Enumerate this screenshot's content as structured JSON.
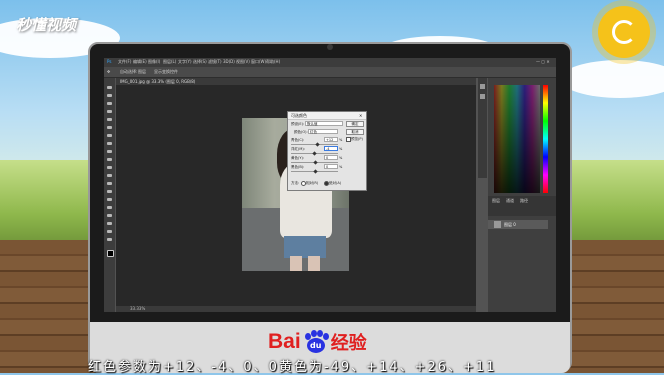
{
  "watermark": "秒懂视频",
  "brand": {
    "bai": "Bai",
    "du": "du",
    "suffix": "经验"
  },
  "caption": "红色参数为+12、-4、0、0黄色为-49、+14、+26、+11",
  "photoshop": {
    "menu": [
      "文件(F)",
      "编辑(E)",
      "图像(I)",
      "图层(L)",
      "文字(Y)",
      "选择(S)",
      "滤镜(T)",
      "3D(D)",
      "视图(V)",
      "窗口(W)",
      "帮助(H)"
    ],
    "options": [
      "自动选择:",
      "图层",
      "显示变换控件"
    ],
    "doc_tab": "IMG_001.jpg @ 33.3% (图层 0, RGB/8)",
    "status": "33.33%",
    "panel_tabs": [
      "图层",
      "通道",
      "路径"
    ],
    "layer_name": "图层 0"
  },
  "dialog": {
    "title": "可选颜色",
    "preset_label": "预设(E):",
    "preset_value": "默认值",
    "colors_label": "颜色(O):",
    "colors_value": "红色",
    "ok": "确定",
    "cancel": "取消",
    "preview": "预览(P)",
    "sliders": [
      {
        "label": "青色(C):",
        "value": "+12",
        "unit": "%"
      },
      {
        "label": "洋红(M):",
        "value": "-4",
        "unit": "%"
      },
      {
        "label": "黄色(Y):",
        "value": "0",
        "unit": "%"
      },
      {
        "label": "黑色(B):",
        "value": "0",
        "unit": "%"
      }
    ],
    "method_label": "方法:",
    "method_relative": "相对(R)",
    "method_absolute": "绝对(A)"
  }
}
